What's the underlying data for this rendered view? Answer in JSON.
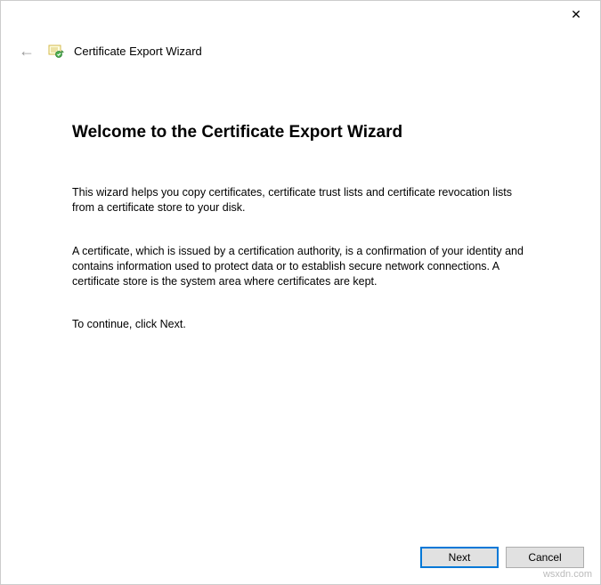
{
  "titlebar": {
    "close_symbol": "✕"
  },
  "header": {
    "back_symbol": "←",
    "wizard_title": "Certificate Export Wizard"
  },
  "content": {
    "heading": "Welcome to the Certificate Export Wizard",
    "para1": "This wizard helps you copy certificates, certificate trust lists and certificate revocation lists from a certificate store to your disk.",
    "para2": "A certificate, which is issued by a certification authority, is a confirmation of your identity and contains information used to protect data or to establish secure network connections. A certificate store is the system area where certificates are kept.",
    "para3": "To continue, click Next."
  },
  "footer": {
    "next_label": "Next",
    "cancel_label": "Cancel"
  },
  "watermark": "wsxdn.com"
}
